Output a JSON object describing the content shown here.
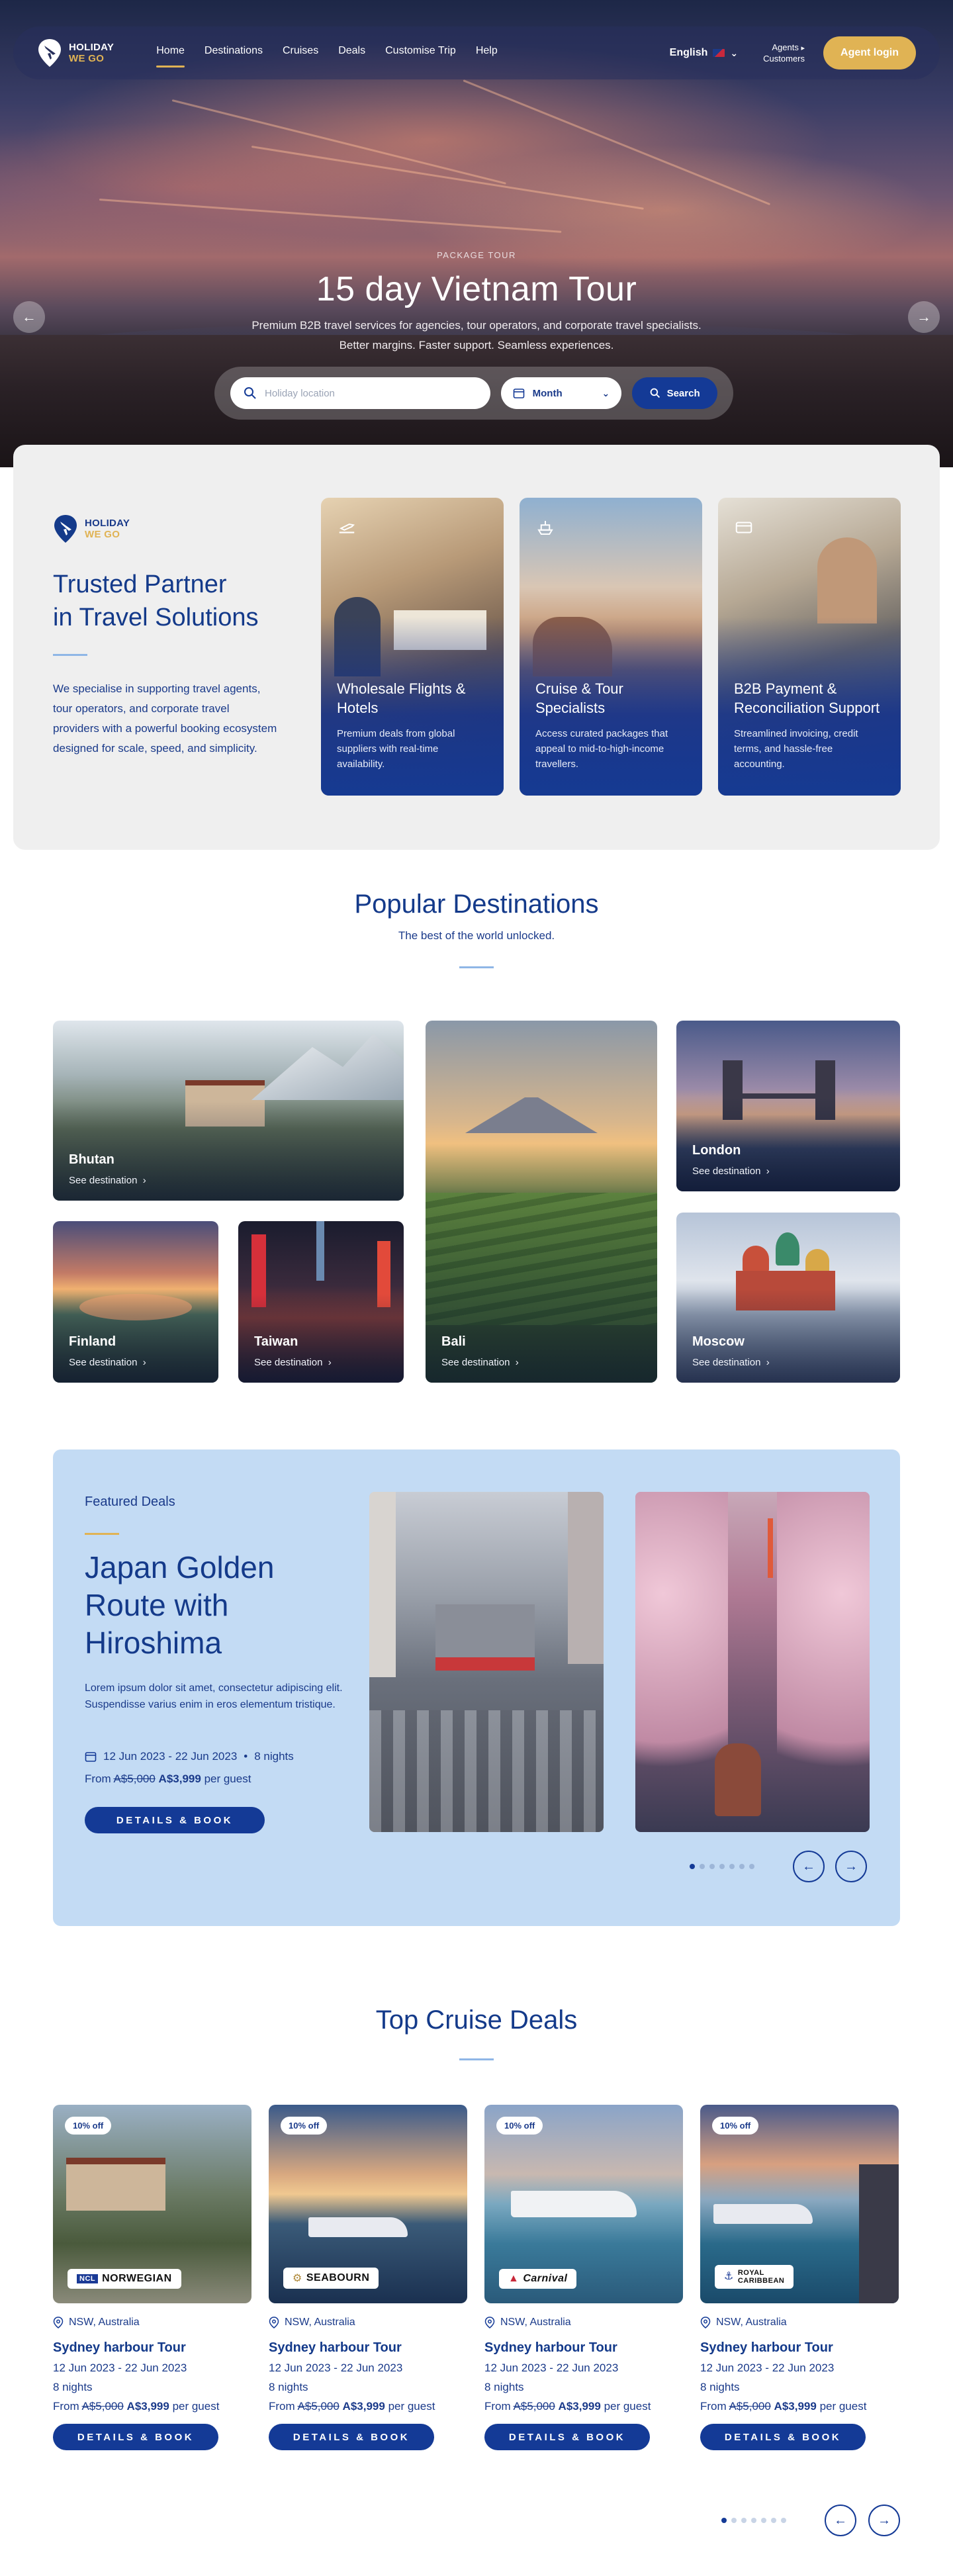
{
  "nav": {
    "logo": {
      "line1": "HOLIDAY",
      "line2": "WE GO"
    },
    "links": [
      "Home",
      "Destinations",
      "Cruises",
      "Deals",
      "Customise Trip",
      "Help"
    ],
    "language": "English",
    "agents_line1": "Agents",
    "agents_line2": "Customers",
    "login_label": "Agent login"
  },
  "hero": {
    "eyebrow": "PACKAGE TOUR",
    "title": "15 day Vietnam Tour",
    "subtitle_line1": "Premium B2B travel services for agencies, tour operators, and corporate travel specialists.",
    "subtitle_line2": "Better margins. Faster support. Seamless experiences.",
    "search_placeholder": "Holiday location",
    "month_label": "Month",
    "search_label": "Search"
  },
  "trusted": {
    "logo": {
      "line1": "HOLIDAY",
      "line2": "WE GO"
    },
    "title_line1": "Trusted Partner",
    "title_line2": "in Travel Solutions",
    "description": "We specialise in supporting travel agents, tour operators, and corporate travel providers with a powerful booking ecosystem designed for scale, speed, and simplicity.",
    "services": [
      {
        "title": "Wholesale Flights & Hotels",
        "desc": "Premium deals from global suppliers with real-time availability.",
        "icon": "plane-icon"
      },
      {
        "title": "Cruise & Tour Specialists",
        "desc": "Access curated packages that appeal to mid-to-high-income travellers.",
        "icon": "ship-icon"
      },
      {
        "title": "B2B Payment & Reconciliation Support",
        "desc": "Streamlined invoicing, credit terms, and hassle-free accounting.",
        "icon": "card-icon"
      }
    ]
  },
  "popular": {
    "title": "Popular Destinations",
    "subtitle": "The best of the world unlocked.",
    "link_label": "See destination",
    "destinations": [
      "Bhutan",
      "Finland",
      "Taiwan",
      "Bali",
      "London",
      "Moscow"
    ]
  },
  "featured": {
    "eyebrow": "Featured Deals",
    "title": "Japan Golden Route with Hiroshima",
    "description": "Lorem ipsum dolor sit amet, consectetur adipiscing elit. Suspendisse varius enim in eros elementum tristique.",
    "dates": "12 Jun 2023 - 22 Jun 2023",
    "nights": "8 nights",
    "price_prefix": "From",
    "price_old": "A$5,000",
    "price_new": "A$3,999",
    "price_suffix": "per guest",
    "button": "DETAILS & BOOK"
  },
  "cruise": {
    "title": "Top Cruise Deals",
    "cards": [
      {
        "badge": "10% off",
        "brand": "NORWEGIAN",
        "location": "NSW, Australia",
        "title": "Sydney harbour Tour",
        "dates": "12 Jun 2023 - 22 Jun 2023",
        "nights": "8 nights",
        "price_prefix": "From",
        "price_old": "A$5,000",
        "price_new": "A$3,999",
        "price_suffix": "per guest",
        "button": "DETAILS & BOOK"
      },
      {
        "badge": "10% off",
        "brand": "SEABOURN",
        "location": "NSW, Australia",
        "title": "Sydney harbour Tour",
        "dates": "12 Jun 2023 - 22 Jun 2023",
        "nights": "8 nights",
        "price_prefix": "From",
        "price_old": "A$5,000",
        "price_new": "A$3,999",
        "price_suffix": "per guest",
        "button": "DETAILS & BOOK"
      },
      {
        "badge": "10% off",
        "brand": "Carnival",
        "location": "NSW, Australia",
        "title": "Sydney harbour Tour",
        "dates": "12 Jun 2023 - 22 Jun 2023",
        "nights": "8 nights",
        "price_prefix": "From",
        "price_old": "A$5,000",
        "price_new": "A$3,999",
        "price_suffix": "per guest",
        "button": "DETAILS & BOOK"
      },
      {
        "badge": "10% off",
        "brand": "ROYAL CARIBBEAN",
        "location": "NSW, Australia",
        "title": "Sydney harbour Tour",
        "dates": "12 Jun 2023 - 22 Jun 2023",
        "nights": "8 nights",
        "price_prefix": "From",
        "price_old": "A$5,000",
        "price_new": "A$3,999",
        "price_suffix": "per guest",
        "button": "DETAILS & BOOK"
      }
    ]
  },
  "colors": {
    "navy": "#143a96",
    "gold": "#e0b354",
    "featured_bg": "#c3dbf4"
  }
}
